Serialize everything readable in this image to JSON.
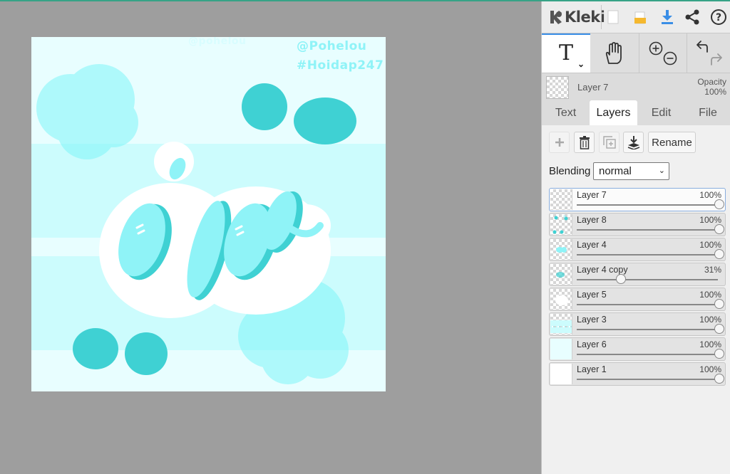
{
  "app": {
    "name": "Kleki"
  },
  "artwork": {
    "watermark_handle": "@Pohelou",
    "watermark_tag": "#Hoidap247",
    "watermark_faint": "@pohelou"
  },
  "topbar": {
    "icons": [
      "new-file-icon",
      "open-folder-icon",
      "download-icon",
      "share-icon",
      "help-icon"
    ]
  },
  "tools": {
    "text_tool_glyph": "T",
    "icons": [
      "text-tool-icon",
      "hand-icon",
      "zoom-in-icon",
      "zoom-out-icon",
      "undo-icon",
      "redo-icon"
    ]
  },
  "current_layer": {
    "name": "Layer 7",
    "opacity_label": "Opacity",
    "opacity_value": "100%"
  },
  "tabs": [
    {
      "label": "Text",
      "active": false
    },
    {
      "label": "Layers",
      "active": true
    },
    {
      "label": "Edit",
      "active": false
    },
    {
      "label": "File",
      "active": false
    }
  ],
  "layer_controls": {
    "rename_label": "Rename",
    "blending_label": "Blending",
    "blending_value": "normal",
    "icons": [
      "add-layer-icon",
      "delete-layer-icon",
      "duplicate-layer-icon",
      "merge-down-icon"
    ]
  },
  "layers": [
    {
      "name": "Layer 7",
      "opacity": "100%",
      "opacity_fraction": 1.0,
      "active": true
    },
    {
      "name": "Layer 8",
      "opacity": "100%",
      "opacity_fraction": 1.0,
      "active": false
    },
    {
      "name": "Layer 4",
      "opacity": "100%",
      "opacity_fraction": 1.0,
      "active": false
    },
    {
      "name": "Layer 4 copy",
      "opacity": "31%",
      "opacity_fraction": 0.31,
      "active": false
    },
    {
      "name": "Layer 5",
      "opacity": "100%",
      "opacity_fraction": 1.0,
      "active": false
    },
    {
      "name": "Layer 3",
      "opacity": "100%",
      "opacity_fraction": 1.0,
      "active": false
    },
    {
      "name": "Layer 6",
      "opacity": "100%",
      "opacity_fraction": 1.0,
      "active": false
    },
    {
      "name": "Layer 1",
      "opacity": "100%",
      "opacity_fraction": 1.0,
      "active": false
    }
  ],
  "colors": {
    "accent_blue": "#3a8ee6",
    "teal": "#3fd1d3",
    "light_cyan": "#8ff3f7",
    "canvas_bg": "#e8feff"
  }
}
